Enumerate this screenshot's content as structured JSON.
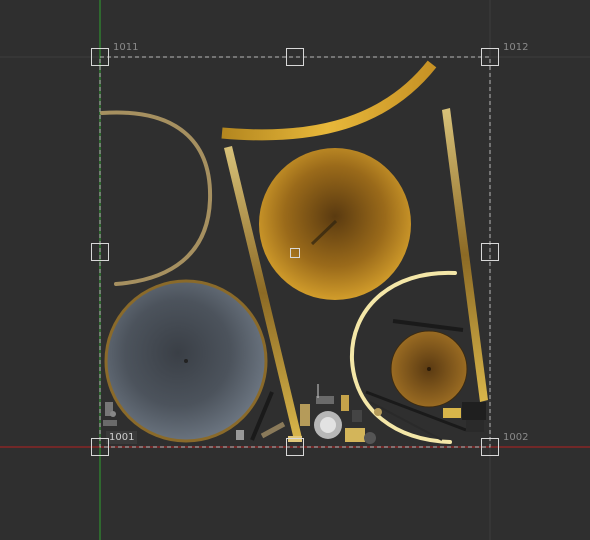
{
  "uv_editor": {
    "tile_labels": {
      "top_left": "1011",
      "top_right": "1012",
      "bottom_left": "1001",
      "bottom_right": "1002"
    },
    "colors": {
      "background": "#2f2f2f",
      "grid_line": "#3c3c3c",
      "v_axis": "#2fa02f",
      "u_axis": "#b52222",
      "selection_border": "#d8d8d8",
      "gold": "#c8962a",
      "dark_gold": "#5a4010",
      "cream": "#f4e7a8",
      "steel": "#5c6470"
    },
    "handles": [
      "top-left",
      "top-middle",
      "top-right",
      "middle-left",
      "center",
      "middle-right",
      "bottom-left",
      "bottom-middle",
      "bottom-right"
    ]
  }
}
